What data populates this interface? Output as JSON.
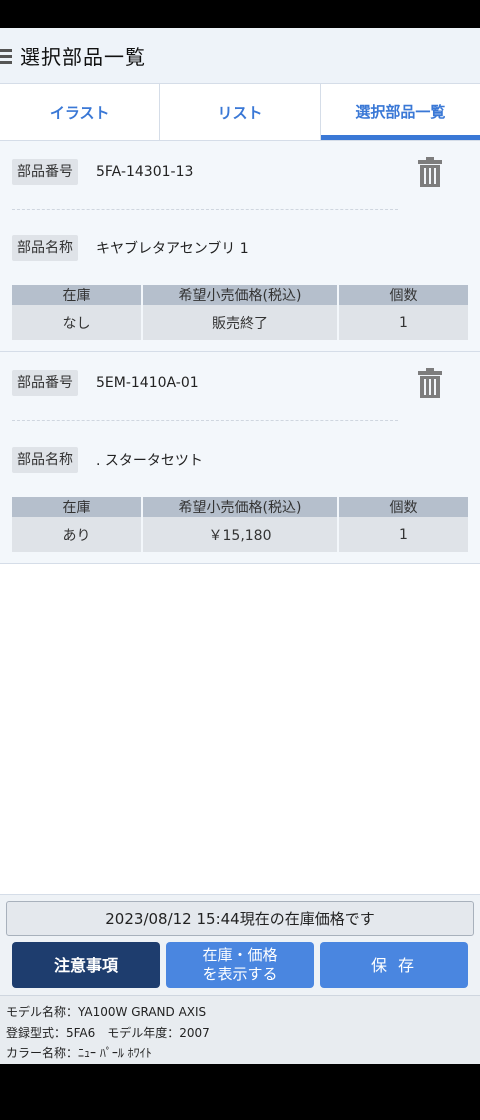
{
  "header": {
    "title": "選択部品一覧"
  },
  "tabs": [
    {
      "label": "イラスト"
    },
    {
      "label": "リスト"
    },
    {
      "label": "選択部品一覧"
    }
  ],
  "parts": [
    {
      "part_number_label": "部品番号",
      "part_number": "5FA-14301-13",
      "part_name_label": "部品名称",
      "part_name": "キヤブレタアセンブリ 1",
      "table_headers": [
        "在庫",
        "希望小売価格(税込)",
        "個数"
      ],
      "stock": "なし",
      "price": "販売終了",
      "quantity": "1"
    },
    {
      "part_number_label": "部品番号",
      "part_number": "5EM-1410A-01",
      "part_name_label": "部品名称",
      "part_name": ". スタータセツト",
      "table_headers": [
        "在庫",
        "希望小売価格(税込)",
        "個数"
      ],
      "stock": "あり",
      "price": "￥15,180",
      "quantity": "1"
    }
  ],
  "footer": {
    "stock_notice": "2023/08/12 15:44現在の在庫価格です",
    "notes_button": "注意事項",
    "show_button_line1": "在庫・価格",
    "show_button_line2": "を表示する",
    "save_button": "保 存",
    "model_name": "モデル名称：YA100W GRAND AXIS",
    "model_type": "登録型式：5FA6　モデル年度：2007",
    "color_name": "カラー名称：ﾆｭｰ ﾊﾟｰﾙ ﾎﾜｲﾄ"
  },
  "colors": {
    "accent": "#3a78d6",
    "dark_button": "#1e3d6e",
    "primary_button": "#4a86e0"
  }
}
